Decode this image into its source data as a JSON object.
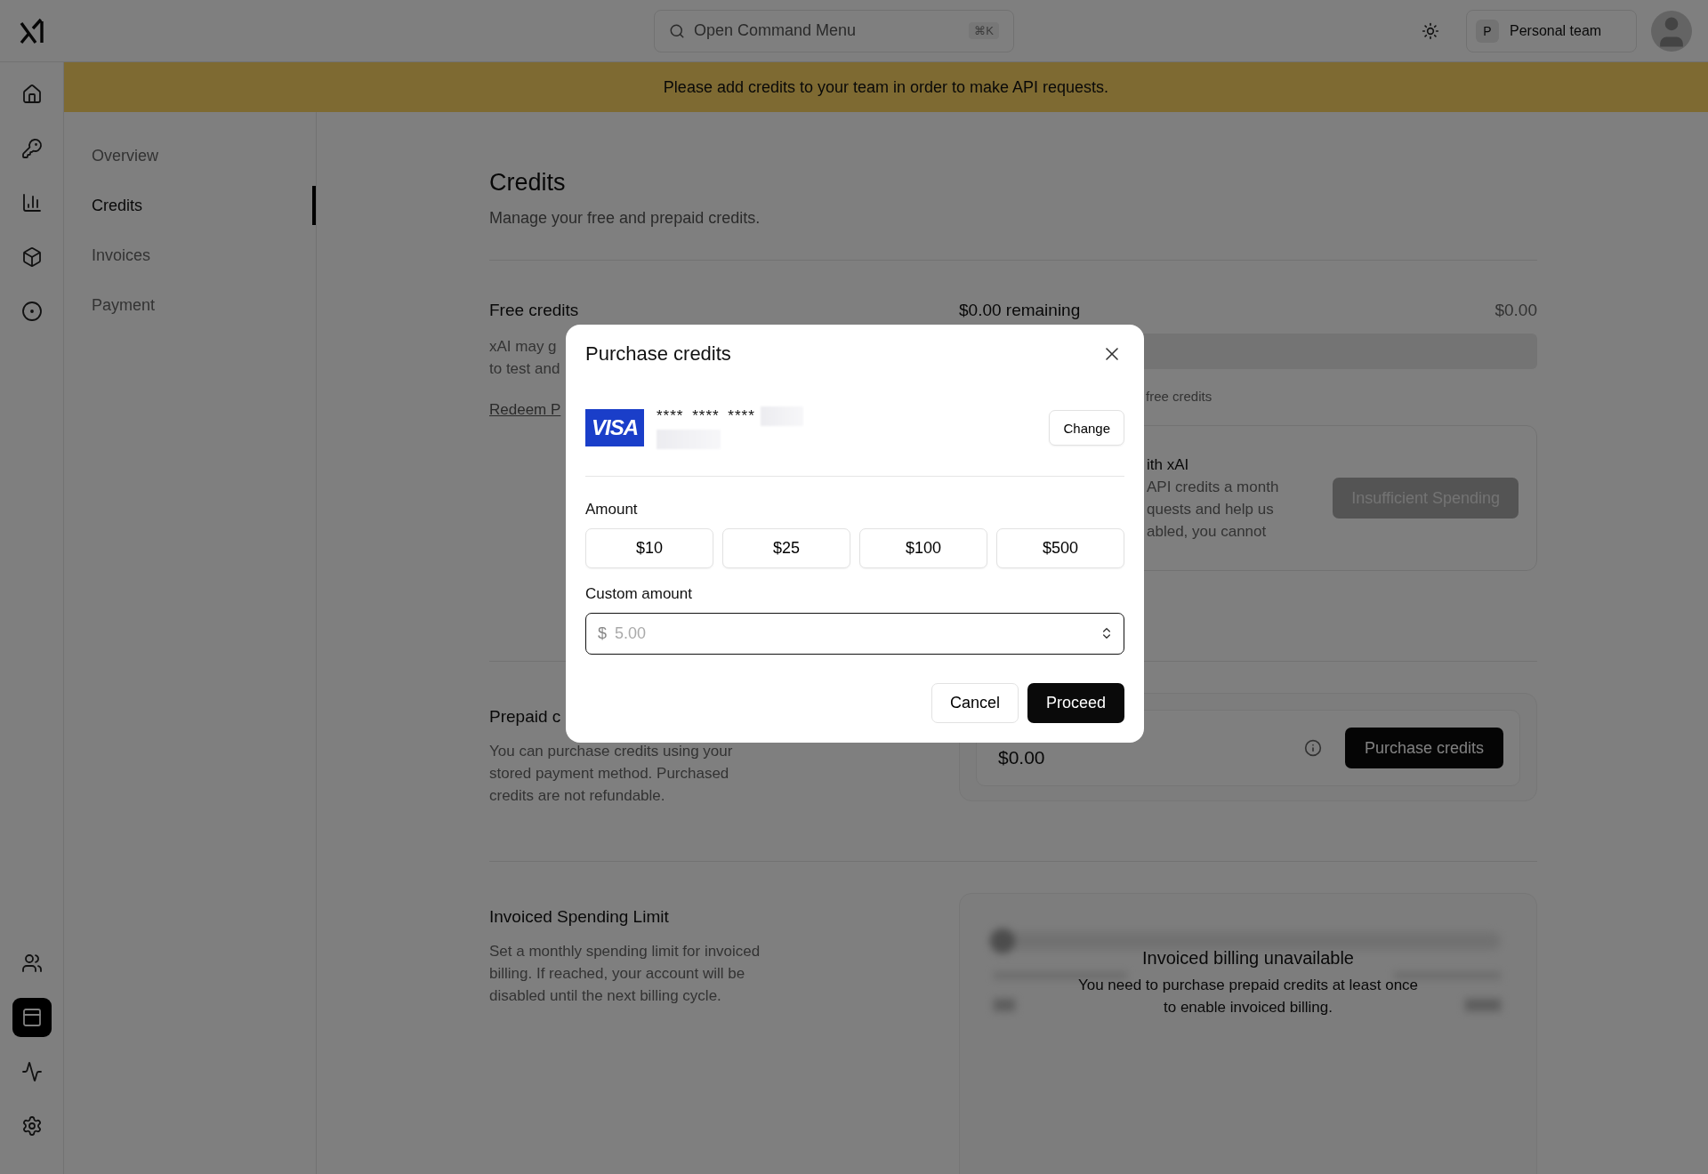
{
  "topbar": {
    "search": {
      "placeholder": "Open Command Menu",
      "shortcut": "⌘K"
    },
    "team": {
      "initial": "P",
      "name": "Personal team"
    }
  },
  "banner": "Please add credits to your team in order to make API requests.",
  "rail": {
    "top": [
      {
        "selected": false
      },
      {
        "selected": false
      },
      {
        "selected": false
      },
      {
        "selected": false
      },
      {
        "selected": false
      }
    ],
    "bottom": [
      {
        "selected": false
      },
      {
        "selected": true
      },
      {
        "selected": false
      },
      {
        "selected": false
      }
    ]
  },
  "subnav": [
    {
      "label": "Overview",
      "selected": false
    },
    {
      "label": "Credits",
      "selected": true
    },
    {
      "label": "Invoices",
      "selected": false
    },
    {
      "label": "Payment",
      "selected": false
    }
  ],
  "page": {
    "title": "Credits",
    "subtitle": "Manage your free and prepaid credits."
  },
  "free_credits": {
    "title": "Free credits",
    "description": [
      "xAI may g",
      "to test and"
    ],
    "link": "Redeem P",
    "remaining": "$0.00 remaining",
    "total": "$0.00",
    "caption": "free credits",
    "program": {
      "title": "ith xAI",
      "lines": [
        "API credits a month",
        "quests and help us",
        "abled, you cannot"
      ]
    },
    "button": "Insufficient Spending"
  },
  "prepaid": {
    "title": "Prepaid c",
    "description": "You can purchase credits using your stored payment method. Purchased credits are not refundable.",
    "balance": "$0.00",
    "button": "Purchase credits"
  },
  "invoiced": {
    "title": "Invoiced Spending Limit",
    "description": "Set a monthly spending limit for invoiced billing. If reached, your account will be disabled until the next billing cycle.",
    "notice_title": "Invoiced billing unavailable",
    "notice": "You need to purchase prepaid credits at least once to enable invoiced billing."
  },
  "modal": {
    "title": "Purchase credits",
    "card_brand": "VISA",
    "card_number": "**** **** ****",
    "change": "Change",
    "amount_label": "Amount",
    "amounts": [
      "$10",
      "$25",
      "$100",
      "$500"
    ],
    "custom_label": "Custom amount",
    "currency": "$",
    "placeholder": "5.00",
    "cancel": "Cancel",
    "proceed": "Proceed"
  }
}
